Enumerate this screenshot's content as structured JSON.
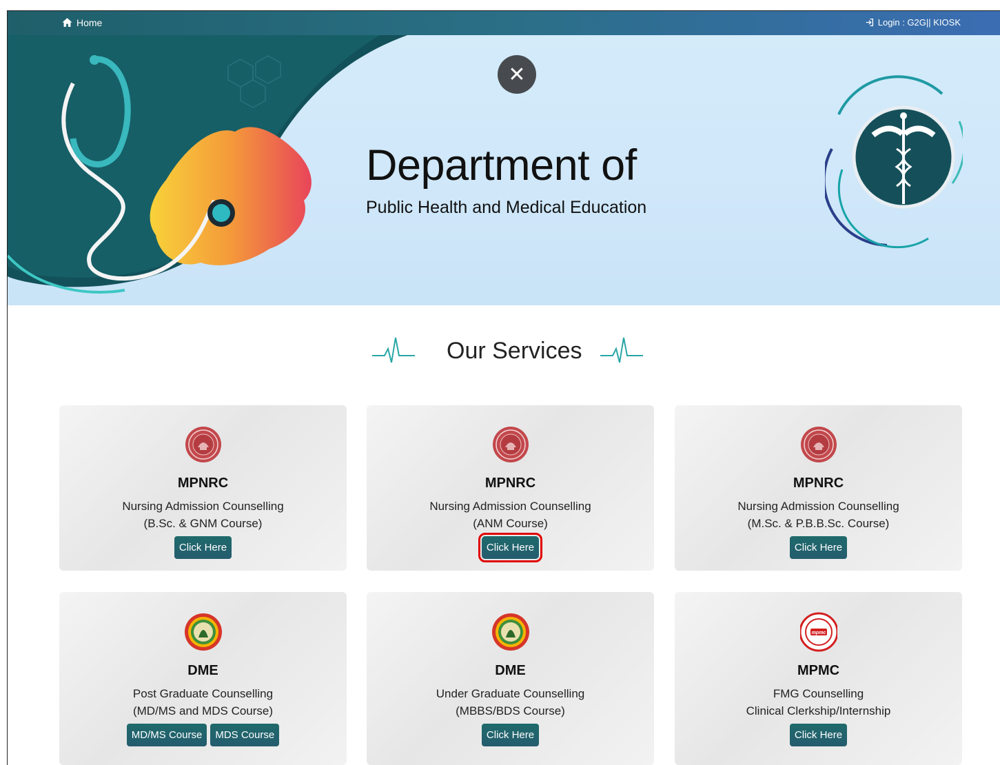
{
  "topbar": {
    "home_label": "Home",
    "login_label": "Login :  G2G|| KIOSK"
  },
  "banner": {
    "close_symbol": "✕",
    "title": "Department of",
    "subtitle": "Public Health and Medical Education"
  },
  "services": {
    "heading": "Our Services",
    "cards": [
      {
        "org": "MPNRC",
        "line1": "Nursing Admission Counselling",
        "line2": "(B.Sc. & GNM Course)",
        "button": "Click Here",
        "seal": "mpnrc-seal-icon"
      },
      {
        "org": "MPNRC",
        "line1": "Nursing Admission Counselling",
        "line2": "(ANM Course)",
        "button": "Click Here",
        "seal": "mpnrc-seal-icon"
      },
      {
        "org": "MPNRC",
        "line1": "Nursing Admission Counselling",
        "line2": "(M.Sc. & P.B.B.Sc. Course)",
        "button": "Click Here",
        "seal": "mpnrc-seal-icon"
      },
      {
        "org": "DME",
        "line1": "Post Graduate Counselling",
        "line2": "(MD/MS and MDS Course)",
        "button1": "MD/MS Course",
        "button2": "MDS Course",
        "seal": "mp-govt-emblem-icon"
      },
      {
        "org": "DME",
        "line1": "Under Graduate Counselling",
        "line2": "(MBBS/BDS Course)",
        "button": "Click Here",
        "seal": "mp-govt-emblem-icon"
      },
      {
        "org": "MPMC",
        "line1": "FMG Counselling",
        "line2": "Clinical Clerkship/Internship",
        "button": "Click Here",
        "seal": "mpmc-seal-icon"
      }
    ]
  },
  "colors": {
    "topbar_start": "#1f5f6a",
    "topbar_end": "#3b6db3",
    "button": "#1f6a6b",
    "highlight": "#e00000",
    "banner_bg": "#d4ebfa"
  }
}
